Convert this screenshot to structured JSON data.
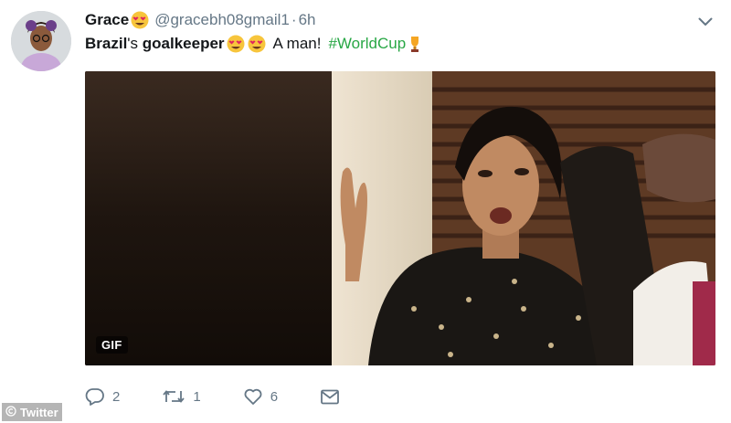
{
  "tweet": {
    "author_name": "Grace",
    "author_handle": "@gracebh08gmail1",
    "separator": "·",
    "time": "6h",
    "text_bold_1": "Brazil",
    "text_1": "'s ",
    "text_bold_2": "goalkeeper",
    "text_2": "A man!",
    "hashtag": "#WorldCup",
    "media_badge": "GIF"
  },
  "actions": {
    "reply_count": "2",
    "retweet_count": "1",
    "like_count": "6"
  },
  "watermark": {
    "label": "Twitter"
  },
  "icons": {
    "caret": "chevron-down-icon",
    "reply": "reply-icon",
    "retweet": "retweet-icon",
    "like": "heart-icon",
    "message": "envelope-icon",
    "emoji": "heart-eyes-emoji-icon",
    "trophy": "trophy-icon"
  },
  "colors": {
    "hashtag": "#28a745",
    "muted": "#657786",
    "emoji_face": "#f7c53c"
  }
}
